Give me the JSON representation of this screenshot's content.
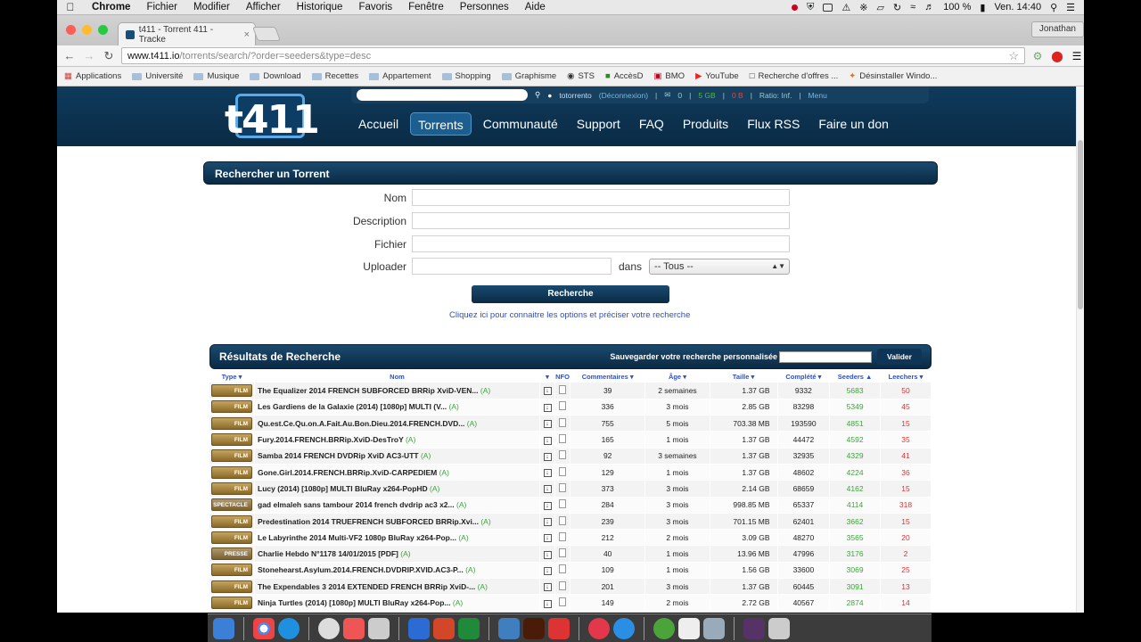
{
  "menubar": {
    "app": "Chrome",
    "menus": [
      "Fichier",
      "Modifier",
      "Afficher",
      "Historique",
      "Favoris",
      "Fenêtre",
      "Personnes",
      "Aide"
    ],
    "battery": "100 %",
    "clock": "Ven. 14:40"
  },
  "browser": {
    "tab_title": "t411 - Torrent 411 - Tracke",
    "profile": "Jonathan",
    "url_host": "www.t411.io",
    "url_path": "/torrents/search/?order=seeders&type=desc",
    "bookmarks": [
      "Applications",
      "Université",
      "Musique",
      "Download",
      "Recettes",
      "Appartement",
      "Shopping",
      "Graphisme",
      "STS",
      "AccèsD",
      "BMO",
      "YouTube",
      "Recherche d'offres ...",
      "Désinstaller Windo..."
    ]
  },
  "site": {
    "logo": "t411",
    "topbar": {
      "user": "totorrento",
      "logout": "(Déconnexion)",
      "count": "0",
      "up": "5 GB",
      "down": "0 B",
      "ratio": "Ratio: Inf.",
      "menu": "Menu"
    },
    "nav": [
      "Accueil",
      "Torrents",
      "Communauté",
      "Support",
      "FAQ",
      "Produits",
      "Flux RSS",
      "Faire un don"
    ]
  },
  "search": {
    "title": "Rechercher un Torrent",
    "labels": {
      "nom": "Nom",
      "description": "Description",
      "fichier": "Fichier",
      "uploader": "Uploader",
      "dans": "dans"
    },
    "select_value": "-- Tous --",
    "button": "Recherche",
    "help": "Cliquez ici pour connaitre les options et préciser votre recherche"
  },
  "results": {
    "title": "Résultats de Recherche",
    "save_label": "Sauvegarder votre recherche personnalisée",
    "validate": "Valider",
    "columns": [
      "Type",
      "Nom",
      "NFO",
      "Commentaires",
      "Âge",
      "Taille",
      "Complété",
      "Seeders",
      "Leechers"
    ],
    "rows": [
      {
        "type": "FILM",
        "name": "The Equalizer 2014 FRENCH SUBFORCED BRRip XviD-VEN...",
        "tag": "(A)",
        "comments": "39",
        "age": "2 semaines",
        "size": "1.37 GB",
        "completed": "9332",
        "seeders": "5683",
        "leechers": "50"
      },
      {
        "type": "FILM",
        "name": "Les Gardiens de la Galaxie (2014) [1080p] MULTI (V...",
        "tag": "(A)",
        "comments": "336",
        "age": "3 mois",
        "size": "2.85 GB",
        "completed": "83298",
        "seeders": "5349",
        "leechers": "45"
      },
      {
        "type": "FILM",
        "name": "Qu.est.Ce.Qu.on.A.Fait.Au.Bon.Dieu.2014.FRENCH.DVD...",
        "tag": "(A)",
        "comments": "755",
        "age": "5 mois",
        "size": "703.38 MB",
        "completed": "193590",
        "seeders": "4851",
        "leechers": "15"
      },
      {
        "type": "FILM",
        "name": "Fury.2014.FRENCH.BRRip.XviD-DesTroY",
        "tag": "(A)",
        "comments": "165",
        "age": "1 mois",
        "size": "1.37 GB",
        "completed": "44472",
        "seeders": "4592",
        "leechers": "35"
      },
      {
        "type": "FILM",
        "name": "Samba 2014 FRENCH DVDRip XviD AC3-UTT",
        "tag": "(A)",
        "comments": "92",
        "age": "3 semaines",
        "size": "1.37 GB",
        "completed": "32935",
        "seeders": "4329",
        "leechers": "41"
      },
      {
        "type": "FILM",
        "name": "Gone.Girl.2014.FRENCH.BRRip.XviD-CARPEDIEM",
        "tag": "(A)",
        "comments": "129",
        "age": "1 mois",
        "size": "1.37 GB",
        "completed": "48602",
        "seeders": "4224",
        "leechers": "36"
      },
      {
        "type": "FILM",
        "name": "Lucy (2014) [1080p] MULTI BluRay x264-PopHD",
        "tag": "(A)",
        "comments": "373",
        "age": "3 mois",
        "size": "2.14 GB",
        "completed": "68659",
        "seeders": "4162",
        "leechers": "15"
      },
      {
        "type": "SPECTACLE",
        "name": "gad elmaleh sans tambour 2014 french dvdrip ac3 x2...",
        "tag": "(A)",
        "comments": "284",
        "age": "3 mois",
        "size": "998.85 MB",
        "completed": "65337",
        "seeders": "4114",
        "leechers": "318"
      },
      {
        "type": "FILM",
        "name": "Predestination 2014 TRUEFRENCH SUBFORCED BRRip.Xvi...",
        "tag": "(A)",
        "comments": "239",
        "age": "3 mois",
        "size": "701.15 MB",
        "completed": "62401",
        "seeders": "3662",
        "leechers": "15"
      },
      {
        "type": "FILM",
        "name": "Le Labyrinthe 2014 Multi-VF2 1080p BluRay x264-Pop...",
        "tag": "(A)",
        "comments": "212",
        "age": "2 mois",
        "size": "3.09 GB",
        "completed": "48270",
        "seeders": "3565",
        "leechers": "20"
      },
      {
        "type": "PRESSE",
        "name": "Charlie Hebdo N°1178 14/01/2015 [PDF]",
        "tag": "(A)",
        "comments": "40",
        "age": "1 mois",
        "size": "13.96 MB",
        "completed": "47996",
        "seeders": "3176",
        "leechers": "2"
      },
      {
        "type": "FILM",
        "name": "Stonehearst.Asylum.2014.FRENCH.DVDRIP.XVID.AC3-P...",
        "tag": "(A)",
        "comments": "109",
        "age": "1 mois",
        "size": "1.56 GB",
        "completed": "33600",
        "seeders": "3069",
        "leechers": "25"
      },
      {
        "type": "FILM",
        "name": "The Expendables 3 2014 EXTENDED FRENCH BRRip XviD-...",
        "tag": "(A)",
        "comments": "201",
        "age": "3 mois",
        "size": "1.37 GB",
        "completed": "60445",
        "seeders": "3091",
        "leechers": "13"
      },
      {
        "type": "FILM",
        "name": "Ninja Turtles (2014) [1080p] MULTI BluRay x264-Pop...",
        "tag": "(A)",
        "comments": "149",
        "age": "2 mois",
        "size": "2.72 GB",
        "completed": "40567",
        "seeders": "2874",
        "leechers": "14"
      }
    ]
  },
  "colors": {
    "header": "#0f3a5c",
    "seeders": "#3aa53a",
    "leechers": "#dd3333",
    "link": "#2a4fcc"
  }
}
